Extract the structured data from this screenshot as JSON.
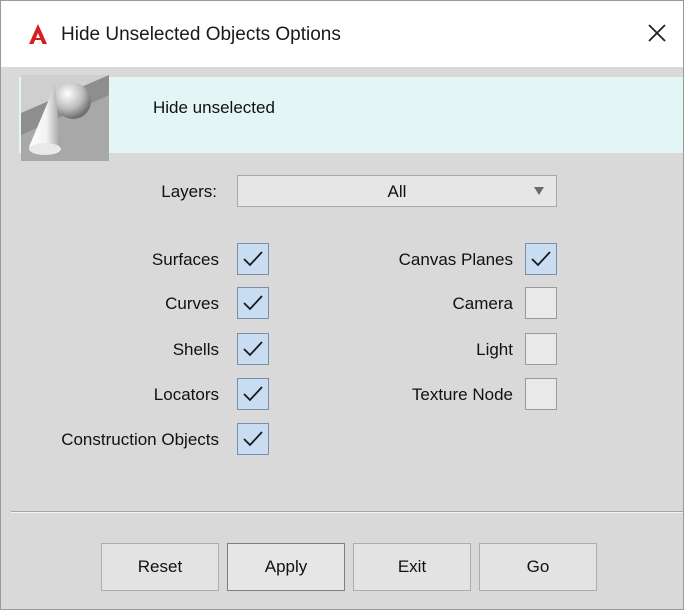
{
  "window": {
    "title": "Hide Unselected Objects Options",
    "close_glyph": "✕",
    "accent_color": "#d51f1f"
  },
  "header": {
    "text": "Hide unselected",
    "image_icon": "cone-sphere-icon"
  },
  "layers": {
    "label": "Layers:",
    "value": "All"
  },
  "left_options": [
    {
      "label": "Surfaces",
      "checked": true
    },
    {
      "label": "Curves",
      "checked": true
    },
    {
      "label": "Shells",
      "checked": true
    },
    {
      "label": "Locators",
      "checked": true
    },
    {
      "label": "Construction Objects",
      "checked": true
    }
  ],
  "right_options": [
    {
      "label": "Canvas Planes",
      "checked": true
    },
    {
      "label": "Camera",
      "checked": false
    },
    {
      "label": "Light",
      "checked": false
    },
    {
      "label": "Texture Node",
      "checked": false
    }
  ],
  "buttons": {
    "reset": "Reset",
    "apply": "Apply",
    "exit": "Exit",
    "go": "Go"
  }
}
